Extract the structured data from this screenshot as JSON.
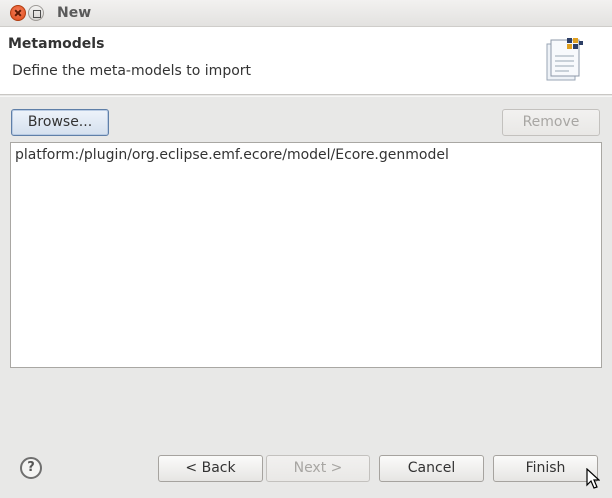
{
  "window": {
    "title": "New"
  },
  "header": {
    "title": "Metamodels",
    "description": "Define the meta-models to import",
    "icon": "wizard-banner-icon"
  },
  "toolbar": {
    "browse_label": "Browse...",
    "remove_label": "Remove"
  },
  "metamodels": {
    "items": [
      "platform:/plugin/org.eclipse.emf.ecore/model/Ecore.genmodel"
    ]
  },
  "footer": {
    "help_symbol": "?",
    "back_label": "< Back",
    "next_label": "Next >",
    "cancel_label": "Cancel",
    "finish_label": "Finish"
  }
}
